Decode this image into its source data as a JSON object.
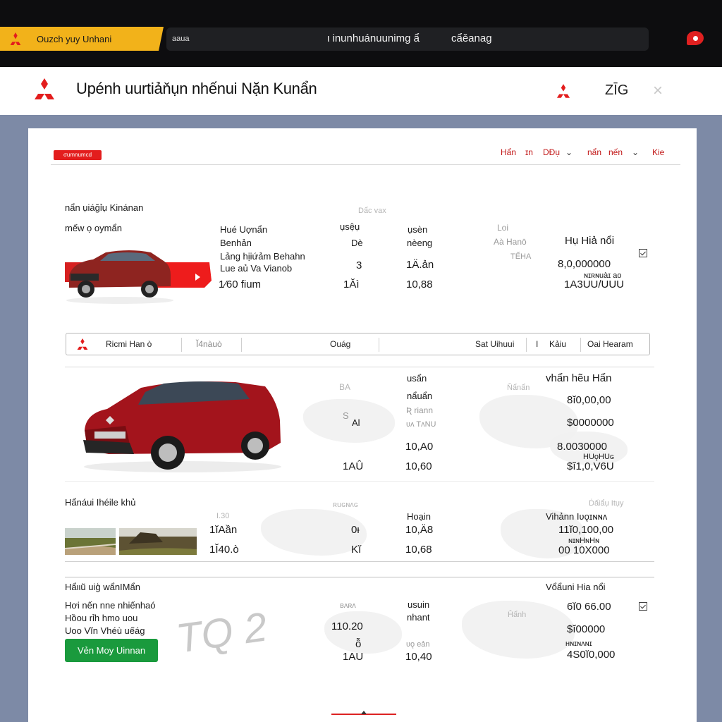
{
  "browser": {
    "tab_title": "Ouzch yuy Unhani",
    "url_left": "aaua",
    "url_mid": "ι inunhuánuunimg ẩ",
    "url_right": "cẩěanag"
  },
  "header": {
    "title": "Upénh uurtiảňụn nhếnui Nặn Kunẩn",
    "code": "ZĪG",
    "close": "×"
  },
  "card": {
    "badge": "σumnumcd",
    "nav": [
      "Hẩn",
      "ɪn",
      "DĐụ",
      "⌄",
      "nẩn",
      "nến",
      "⌄",
      "Kie"
    ],
    "section1": {
      "heading": "nẩn ụiáğỉụ Kinánan",
      "subheading": "mếw ọ oymẩn",
      "col_hint": "Dẩc vax",
      "specs": [
        "Hué Uợnẩn",
        "Benhản",
        "Lảng hịiứảm Behahn",
        "Lue aủ Va Vianob",
        "1⁄60 fium"
      ],
      "col_a": [
        "ụsệụ",
        "Dè",
        "3",
        "1Ăì"
      ],
      "col_b": [
        "ụsèn",
        "nèeng",
        "1Ä.ản",
        "10,88"
      ],
      "col_c": [
        "Loi",
        "Aà Hanō",
        "TẾHA"
      ],
      "price_label": "Hụ Hiả nổi",
      "price_rows": [
        "8,0,000000",
        "ɴɪʀɴuàɪ ao",
        "1A3UU/UUU"
      ]
    },
    "filter": {
      "cells": [
        "Ricmi  Han ò",
        "Ĭ4nàuò",
        "Ouág",
        "Sat Uihuui",
        "I",
        "Kảiu",
        "Oai  Hearam"
      ]
    },
    "section2": {
      "col_a": [
        "BA",
        "S",
        "Al",
        "1AÛ"
      ],
      "col_b": [
        "usẩn",
        "nẩuẩn",
        "Ʀ riann",
        "ʋʌ TʌNU",
        "10,A0",
        "10,60"
      ],
      "map_label": "Ňẩnẩn",
      "price_label": "vhẩn hẽu Hẩn",
      "price_rows": [
        "8ĭ0,00,00",
        "$0000000",
        "8.0030000",
        "HUǫHUɢ",
        "$ĭ1,0,V6U"
      ]
    },
    "section3": {
      "heading": "Hẩnáui Ihéile khủ",
      "col_hint_a": "I.30",
      "col_hint_b": "ʀuɢɴʌɢ",
      "col_a": [
        "1ĭAần",
        "1Ĭ40.ò"
      ],
      "col_b": [
        "0ᵻ",
        "Kĭ"
      ],
      "col_c": [
        "Hoạin",
        "10,Ä8",
        "10,68"
      ],
      "price_hint": "Ḋấiẩụ Itụy",
      "price_label": "Vihảnn Iʋǫɪɴɴʌ",
      "price_rows": [
        "11ĭ0,100,00",
        "ɴɪɴHɴHɴ",
        "00 10X000"
      ]
    },
    "section4": {
      "heading": "Hẩιιũ uiģ wẩnIMẩn",
      "desc": [
        "Hơi nến nne nhiếnhaó",
        "Hồou rỉh hmo uou",
        "Uoo Vĭn Vhéù uếág"
      ],
      "col_hint": "ʙʌʀʌ",
      "col_a": [
        "110.20",
        "ỗ",
        "1AU"
      ],
      "col_b": [
        "usuin",
        "nhant",
        "ʋǫ eản",
        "10,40"
      ],
      "price_label": "Vổẩuni Hia nổi",
      "price_rows": [
        "6ĭ0 66.00",
        "$ĭ00000",
        "ʜɴɪɴʌɴɪ",
        "4S0ĭ0,000"
      ],
      "map_label": "Ĥẩnh",
      "watermark": "TQ 2",
      "cta": "Vẻn Moy Uinnan"
    }
  },
  "colors": {
    "brand_red": "#e31d1d",
    "tab_yellow": "#f2b21a",
    "cta_green": "#1a9a3d",
    "page_bg": "#7d8aa6"
  }
}
